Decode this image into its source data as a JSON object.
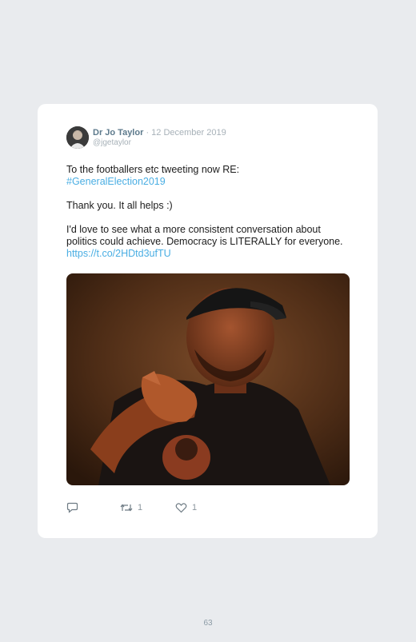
{
  "tweet": {
    "author_name": "Dr Jo Taylor",
    "separator": "·",
    "date": "12 December 2019",
    "handle": "@jgetaylor",
    "paragraphs": [
      {
        "text": "To the footballers etc tweeting now RE:",
        "hashtag": "#GeneralElection2019"
      },
      {
        "text": "Thank you. It all helps :)"
      },
      {
        "text": "I'd love to see what a more consistent conversation about politics could achieve. Democracy is LITERALLY for everyone. ",
        "link": "https://t.co/2HDtd3ufTU"
      }
    ],
    "actions": {
      "reply_icon": "reply-icon",
      "retweet_icon": "retweet-icon",
      "retweet_count": "1",
      "like_icon": "heart-icon",
      "like_count": "1"
    },
    "colors": {
      "name": "#5d7a8c",
      "link": "#4aaee3",
      "meta": "#a7b1b8"
    }
  },
  "page": {
    "number": "63"
  }
}
